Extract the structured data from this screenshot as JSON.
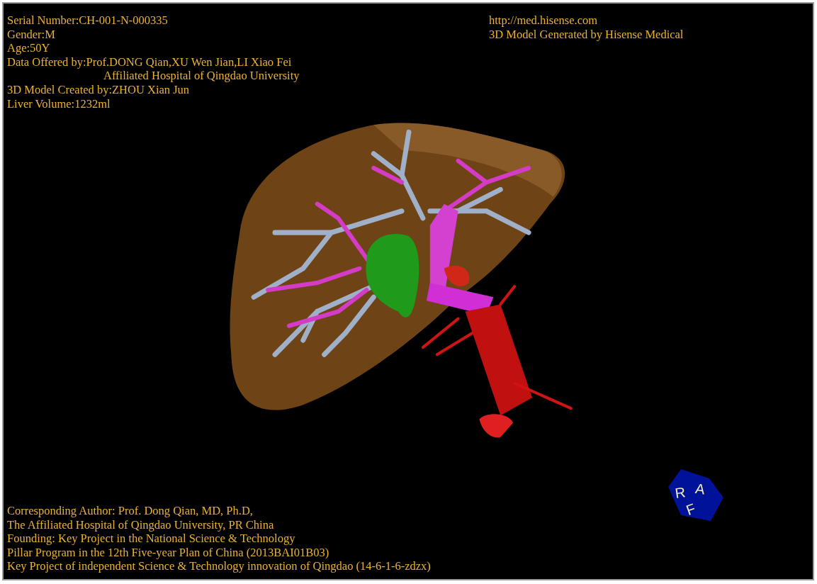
{
  "case_info": {
    "lines": [
      {
        "text": "Serial Number:CH-001-N-000335"
      },
      {
        "text": "Gender:M"
      },
      {
        "text": "Age:50Y"
      },
      {
        "text": "Data Offered by:Prof.DONG Qian,XU Wen Jian,LI Xiao Fei",
        "continuation": "Affiliated Hospital of Qingdao University"
      },
      {
        "text": "3D Model Created by:ZHOU Xian Jun"
      },
      {
        "text": "Liver Volume:1232ml"
      }
    ]
  },
  "branding": {
    "lines": [
      "http://med.hisense.com",
      "3D Model Generated by Hisense Medical"
    ]
  },
  "credits": {
    "lines": [
      "Corresponding Author: Prof. Dong Qian, MD, Ph.D,",
      "The Affiliated Hospital of Qingdao University, PR China",
      "Founding: Key Project in the National Science & Technology",
      "Pillar Program in the 12th Five-year Plan of China (2013BAI01B03)",
      "Key Project of independent Science & Technology innovation of Qingdao (14-6-1-6-zdzx)"
    ]
  },
  "orientation_cube": {
    "faces": [
      "R",
      "A",
      "F"
    ]
  }
}
